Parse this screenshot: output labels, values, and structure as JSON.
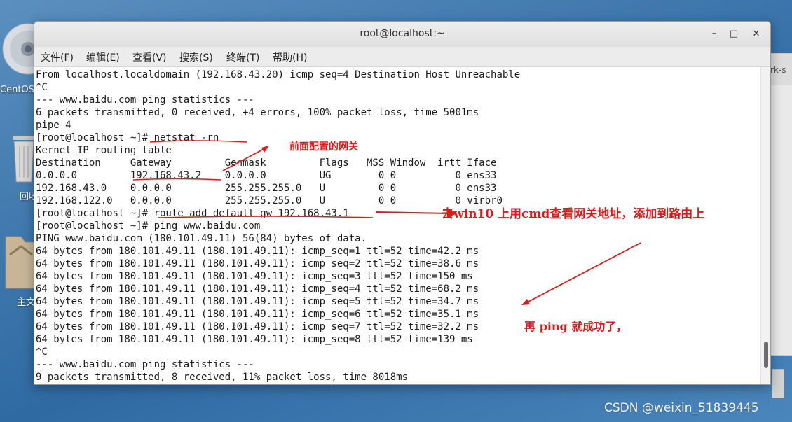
{
  "desktop": {
    "disc_label": "CentOS",
    "trash_label": "回收",
    "home_label": "主文"
  },
  "background_window": {
    "title_fragment": "rk-s"
  },
  "window": {
    "title": "root@localhost:~",
    "controls": {
      "minimize": "–",
      "maximize": "□",
      "close": "✕"
    }
  },
  "menu": [
    "文件(F)",
    "编辑(E)",
    "查看(V)",
    "搜索(S)",
    "终端(T)",
    "帮助(H)"
  ],
  "terminal_lines": [
    "From localhost.localdomain (192.168.43.20) icmp_seq=4 Destination Host Unreachable",
    "^C",
    "--- www.baidu.com ping statistics ---",
    "6 packets transmitted, 0 received, +4 errors, 100% packet loss, time 5001ms",
    "pipe 4",
    "[root@localhost ~]# netstat -rn",
    "Kernel IP routing table",
    "Destination     Gateway         Genmask         Flags   MSS Window  irtt Iface",
    "0.0.0.0         192.168.43.2    0.0.0.0         UG        0 0          0 ens33",
    "192.168.43.0    0.0.0.0         255.255.255.0   U         0 0          0 ens33",
    "192.168.122.0   0.0.0.0         255.255.255.0   U         0 0          0 virbr0",
    "[root@localhost ~]# route add default gw 192.168.43.1",
    "[root@localhost ~]# ping www.baidu.com",
    "PING www.baidu.com (180.101.49.11) 56(84) bytes of data.",
    "64 bytes from 180.101.49.11 (180.101.49.11): icmp_seq=1 ttl=52 time=42.2 ms",
    "64 bytes from 180.101.49.11 (180.101.49.11): icmp_seq=2 ttl=52 time=38.6 ms",
    "64 bytes from 180.101.49.11 (180.101.49.11): icmp_seq=3 ttl=52 time=150 ms",
    "64 bytes from 180.101.49.11 (180.101.49.11): icmp_seq=4 ttl=52 time=68.2 ms",
    "64 bytes from 180.101.49.11 (180.101.49.11): icmp_seq=5 ttl=52 time=34.7 ms",
    "64 bytes from 180.101.49.11 (180.101.49.11): icmp_seq=6 ttl=52 time=35.1 ms",
    "64 bytes from 180.101.49.11 (180.101.49.11): icmp_seq=7 ttl=52 time=32.2 ms",
    "64 bytes from 180.101.49.11 (180.101.49.11): icmp_seq=8 ttl=52 time=139 ms",
    "^C",
    "--- www.baidu.com ping statistics ---",
    "9 packets transmitted, 8 received, 11% packet loss, time 8018ms"
  ],
  "annotations": {
    "gateway_note": "前面配置的网关",
    "route_note": "去win10 上用cmd查看网关地址，添加到路由上",
    "ping_note": "再 ping 就成功了，"
  },
  "watermark": "CSDN @weixin_51839445",
  "colors": {
    "annotation": "#e01818",
    "terminal_text": "#1c1c1c",
    "terminal_bg": "#ffffff"
  }
}
